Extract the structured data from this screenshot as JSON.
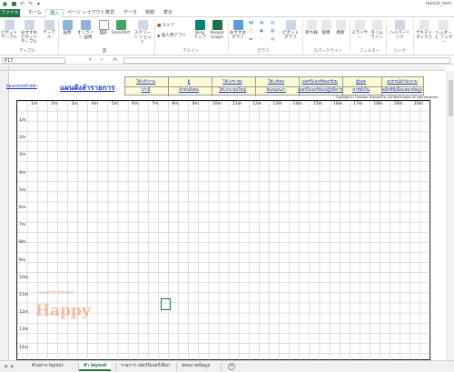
{
  "window": {
    "title": "layout_tem"
  },
  "ribbon_tabs": [
    "ファイル",
    "ホーム",
    "挿入",
    "ページ レイアウト",
    "数式",
    "データ",
    "校閲",
    "表示"
  ],
  "ribbon": {
    "buttons": [
      {
        "label": "ピボット テーブル",
        "icon": "pivot-table-icon"
      },
      {
        "label": "おすすめ ピボットテーブル",
        "icon": "recommended-pivot-icon"
      },
      {
        "label": "テーブル",
        "icon": "table-icon"
      },
      {
        "label": "画像",
        "icon": "picture-icon"
      },
      {
        "label": "オンライン 画像",
        "icon": "online-picture-icon"
      },
      {
        "label": "図形",
        "icon": "shapes-icon"
      },
      {
        "label": "SmartArt",
        "icon": "smartart-icon"
      },
      {
        "label": "スクリーン ショット",
        "icon": "screenshot-icon"
      },
      {
        "label": "Bing マップ",
        "icon": "bing-maps-icon"
      },
      {
        "label": "People Graph",
        "icon": "people-graph-icon"
      },
      {
        "label": "おすすめ グラフ",
        "icon": "recommended-charts-icon"
      },
      {
        "label": "ピボットグラフ",
        "icon": "pivot-chart-icon"
      },
      {
        "label": "折れ線",
        "icon": "sparkline-line-icon"
      },
      {
        "label": "縦棒",
        "icon": "sparkline-column-icon"
      },
      {
        "label": "勝敗",
        "icon": "sparkline-winloss-icon"
      },
      {
        "label": "スライサー",
        "icon": "slicer-icon"
      },
      {
        "label": "タイム ライン",
        "icon": "timeline-icon"
      },
      {
        "label": "ハイパーリンク",
        "icon": "hyperlink-icon"
      },
      {
        "label": "テキスト ボックス",
        "icon": "textbox-icon"
      },
      {
        "label": "ヘッダーと フッター",
        "icon": "header-footer-icon"
      }
    ],
    "store_label": "ストア",
    "myapps_label": "個人用アプリ",
    "groups": [
      "テーブル",
      "図",
      "アドイン",
      "グラフ",
      "スパークライン",
      "フィルター",
      "リンク"
    ]
  },
  "formula_bar": {
    "name_box": "P17",
    "cancel": "✕",
    "enter": "✓",
    "fx": "fx",
    "formula": ""
  },
  "sheet": {
    "back_link": "ย้อนกลับหน้าหลัก",
    "title": "แผนผังลำรายการ",
    "link_grid": [
      [
        "โต๊ะทำงาน",
        "ตู้",
        "โต๊ะประชุม",
        "โต๊ะเขียน",
        "เฟอร์นิเจอร์ห้องเรียน",
        "ผู้บอด",
        "อุปกรณ์สำนักงาน"
      ],
      [
        "เก้าอี้",
        "ลำดับสิ่งต่อ",
        "โต๊ะประชุมใหญ่",
        "ห้องนอนงา",
        "เฟอร์นิเจอร์ห้องปฏิบัติการ",
        "หาที่ตั้งใน",
        "คลิกที่นี่เพื่อแสดงข้อมูล"
      ]
    ],
    "copyright": "Copyright(c) Thainose Thanadr/Co.,Ltd Patent Japan All right Reserved",
    "col_labels": [
      "1m",
      "2m",
      "3m",
      "4m",
      "5m",
      "6m",
      "7m",
      "8m",
      "9m",
      "10m",
      "11m",
      "12m",
      "13m",
      "14m",
      "15m",
      "16m",
      "17m",
      "18m",
      "19m",
      "20m"
    ],
    "row_labels": [
      "1m",
      "2m",
      "3m",
      "4m",
      "5m",
      "6m",
      "7m",
      "8m",
      "9m",
      "10m",
      "11m",
      "12m",
      "13m",
      "14m"
    ],
    "watermark_top": "ทองคำชาดหัวพรร",
    "watermark_main": "Happy"
  },
  "sheet_tabs": [
    "ตัวอย่าง layout",
    "ทำ layout",
    "รายการ เฟอร์นิเจอร์เลือก",
    "สอบถามข้อมูล"
  ],
  "active_sheet_index": 1,
  "colors": {
    "accent": "#217346",
    "link": "#1a35c9",
    "link_box": "#fdfbd3"
  }
}
